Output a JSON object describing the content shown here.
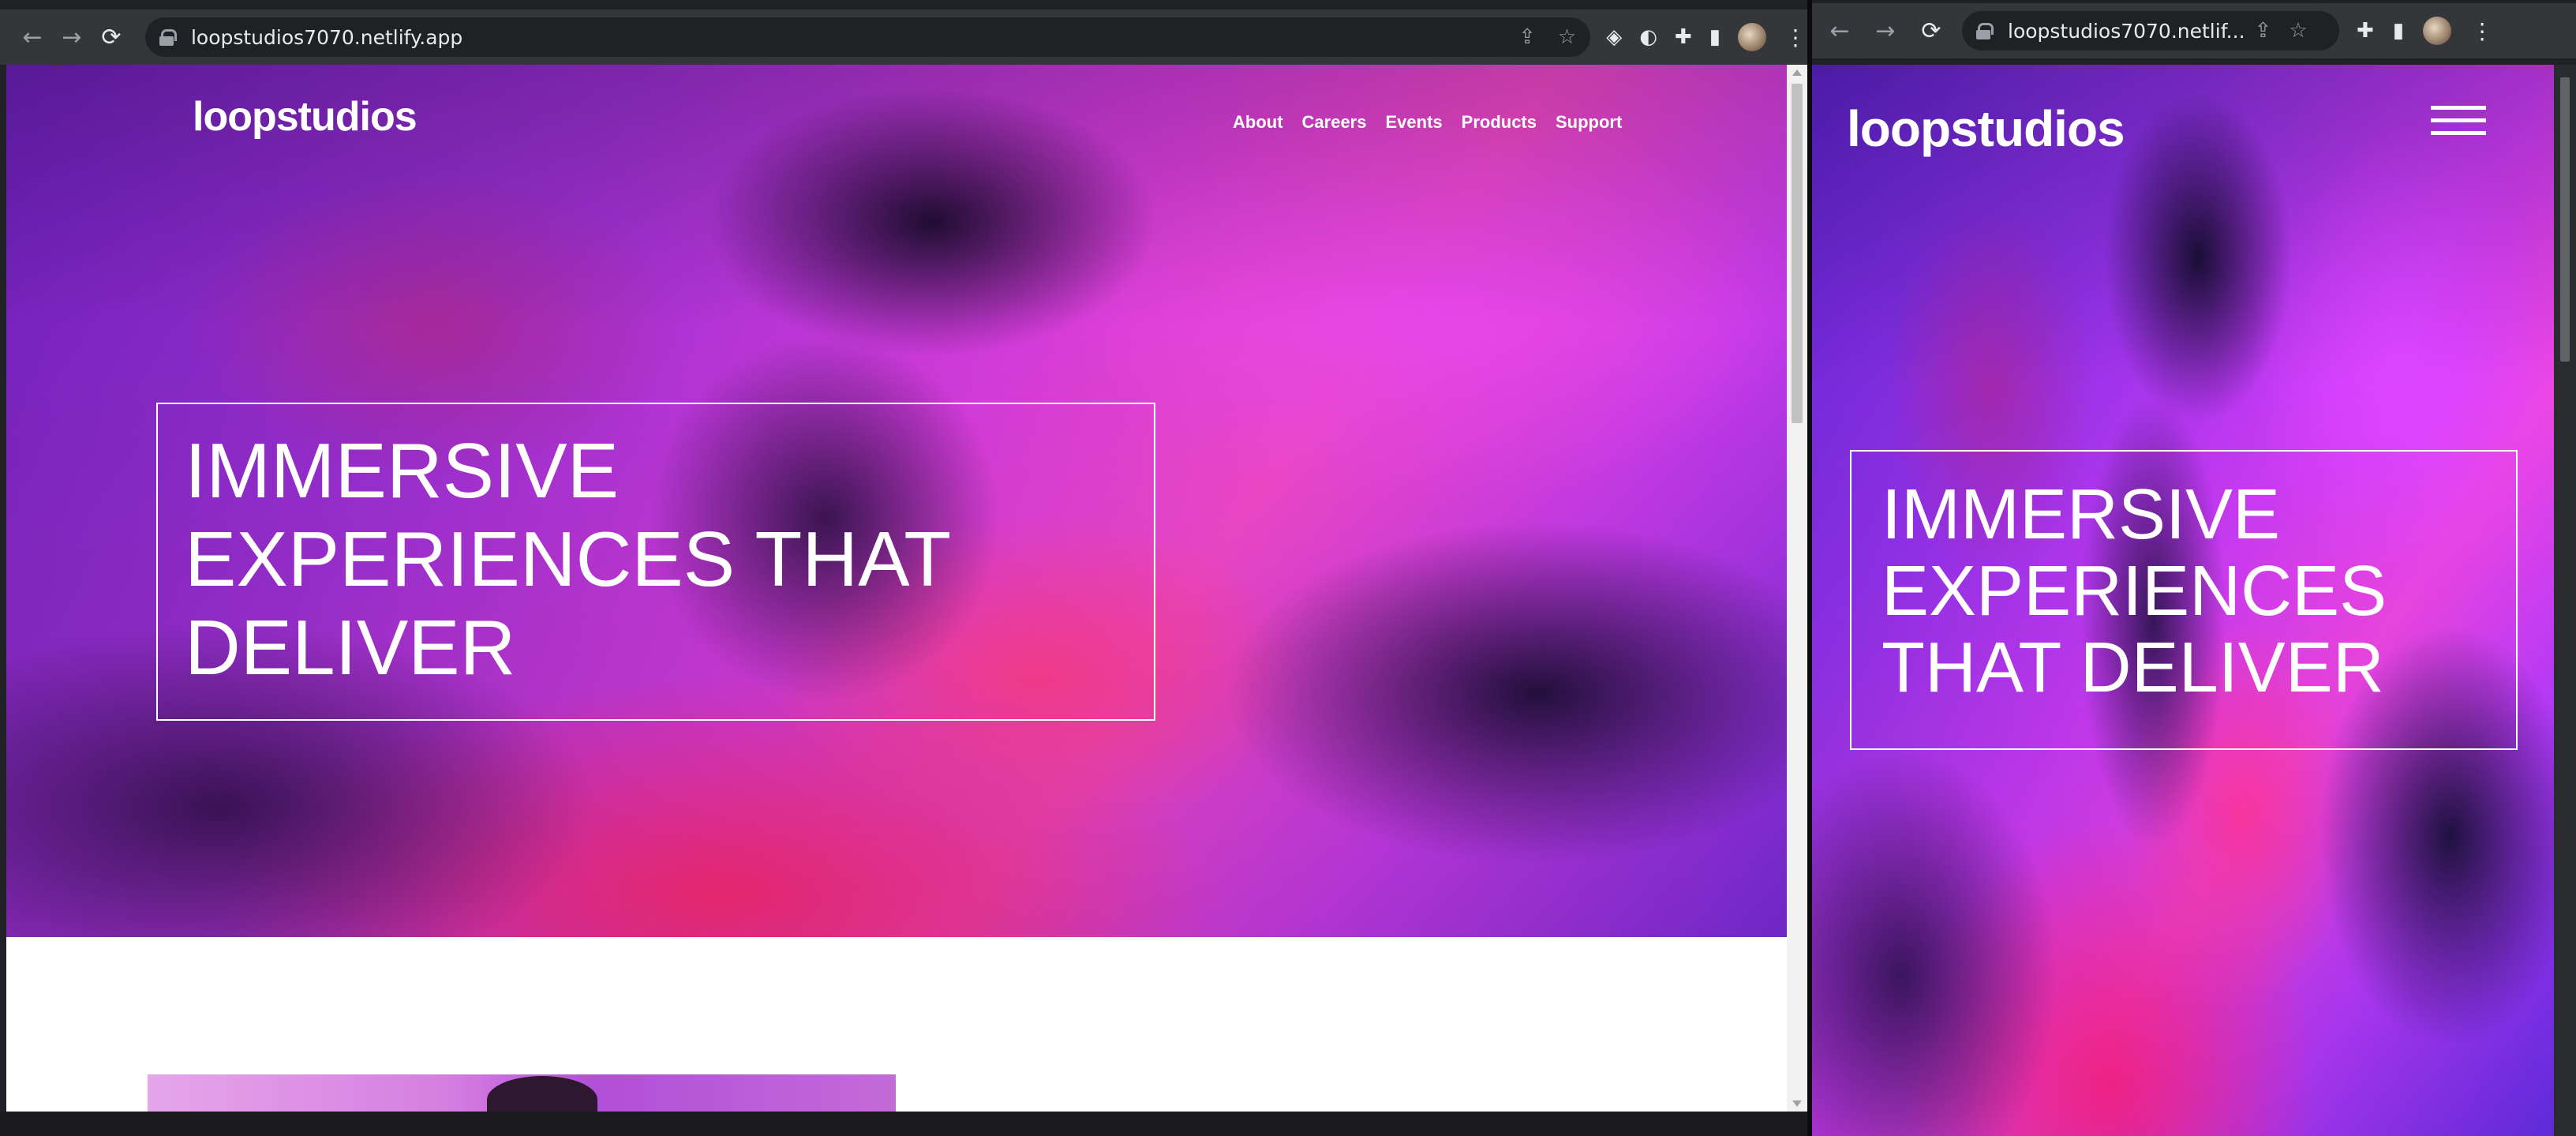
{
  "browser": {
    "url_full": "loopstudios7070.netlify.app",
    "url_truncated": "loopstudios7070.netlif..."
  },
  "site": {
    "logo": "loopstudios",
    "nav": [
      "About",
      "Careers",
      "Events",
      "Products",
      "Support"
    ],
    "hero_title": "IMMERSIVE EXPERIENCES THAT DELIVER"
  },
  "icons": {
    "back": "arrow-left-icon",
    "forward": "arrow-right-icon",
    "reload": "reload-icon",
    "lock": "lock-icon",
    "share": "share-icon",
    "bookmark": "star-icon",
    "extensions": "puzzle-icon",
    "side_panel": "side-panel-icon",
    "menu": "kebab-menu-icon",
    "hamburger": "hamburger-menu-icon"
  },
  "colors": {
    "browser_toolbar": "#35363a",
    "omnibox": "#202124",
    "hero_text": "#ffffff",
    "hero_accent_pink": "#f048c9",
    "hero_accent_purple": "#6a1fb8"
  }
}
